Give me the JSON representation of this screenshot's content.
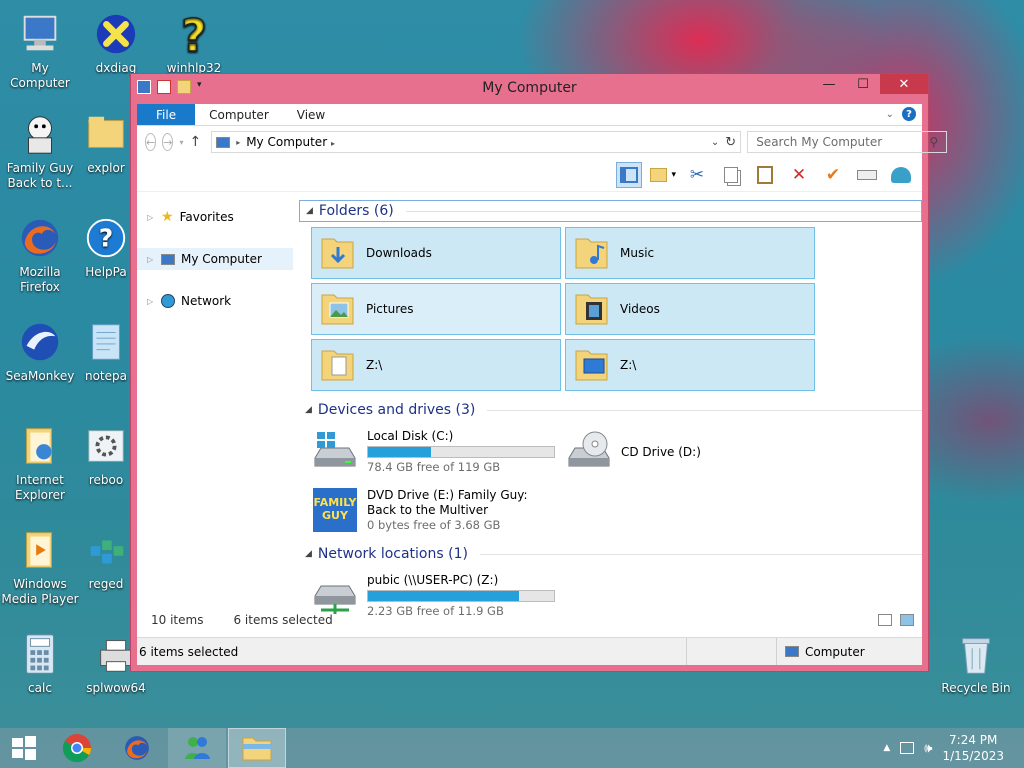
{
  "desktop": {
    "icons": [
      {
        "label": "My Computer",
        "name": "my-computer-icon"
      },
      {
        "label": "dxdiag",
        "name": "dxdiag-icon"
      },
      {
        "label": "winhlp32",
        "name": "winhlp32-icon"
      },
      {
        "label": "Family Guy Back to t...",
        "name": "family-guy-icon"
      },
      {
        "label": "explor",
        "name": "explorer-shortcut-icon"
      },
      {
        "label": "Mozilla Firefox",
        "name": "firefox-icon"
      },
      {
        "label": "HelpPa",
        "name": "helppane-icon"
      },
      {
        "label": "SeaMonkey",
        "name": "seamonkey-icon"
      },
      {
        "label": "notepa",
        "name": "notepad-icon"
      },
      {
        "label": "Internet Explorer",
        "name": "internet-explorer-icon"
      },
      {
        "label": "reboo",
        "name": "reboot-icon"
      },
      {
        "label": "Windows Media Player",
        "name": "windows-media-player-icon"
      },
      {
        "label": "reged",
        "name": "regedit-icon"
      },
      {
        "label": "calc",
        "name": "calc-icon"
      },
      {
        "label": "splwow64",
        "name": "splwow64-icon"
      },
      {
        "label": "Recycle Bin",
        "name": "recycle-bin-icon"
      }
    ]
  },
  "window": {
    "title": "My Computer",
    "controls": {
      "minimize": "—",
      "maximize": "☐",
      "close": "✕"
    }
  },
  "ribbon": {
    "tabs": [
      "File",
      "Computer",
      "View"
    ],
    "help": "?"
  },
  "address": {
    "location": "My Computer",
    "search_placeholder": "Search My Computer"
  },
  "navpane": {
    "items": [
      "Favorites",
      "My Computer",
      "Network"
    ]
  },
  "groups": {
    "folders": "Folders (6)",
    "devices": "Devices and drives (3)",
    "network": "Network locations (1)"
  },
  "folders": [
    {
      "name": "Downloads"
    },
    {
      "name": "Music"
    },
    {
      "name": "Pictures"
    },
    {
      "name": "Videos"
    },
    {
      "name": "Z:\\"
    },
    {
      "name": "Z:\\"
    }
  ],
  "drives": [
    {
      "name": "Local Disk (C:)",
      "free": "78.4 GB free of 119 GB",
      "used_fraction": 0.34
    },
    {
      "name": "CD Drive (D:)"
    },
    {
      "name": "DVD Drive (E:) Family Guy: Back to the Multiver",
      "free": "0 bytes free of 3.68 GB"
    }
  ],
  "network_locations": [
    {
      "name": "pubic (\\\\USER-PC) (Z:)",
      "free": "2.23 GB free of 11.9 GB",
      "used_fraction": 0.81
    }
  ],
  "status": {
    "count": "10 items",
    "selected": "6 items selected",
    "bottom_selected": "6 items selected",
    "bottom_location": "Computer"
  },
  "taskbar": {
    "time": "7:24 PM",
    "date": "1/15/2023"
  },
  "colors": {
    "window_frame": "#e7708f",
    "accent": "#1979ca",
    "selection": "#cde8f5",
    "close": "#c7394b"
  }
}
